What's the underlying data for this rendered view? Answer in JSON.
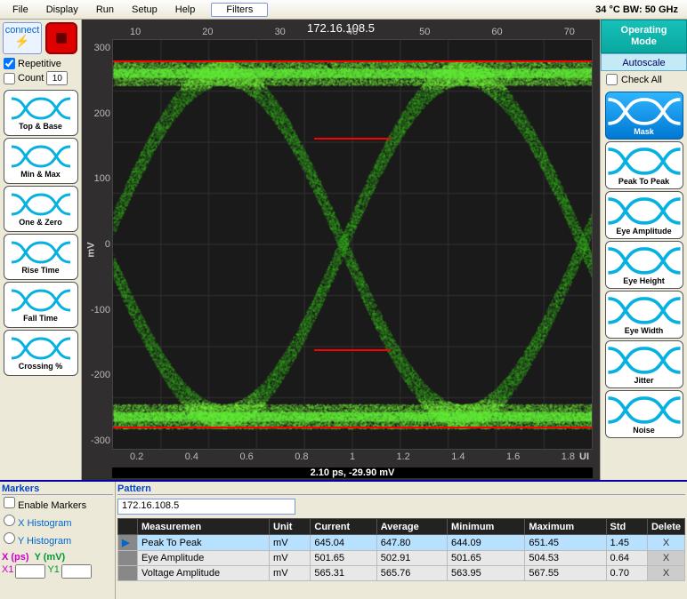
{
  "menu": {
    "items": [
      "File",
      "Display",
      "Run",
      "Setup",
      "Help"
    ],
    "filters": "Filters"
  },
  "status_bar": "34 °C  BW: 50 GHz",
  "controls": {
    "connect": "connect",
    "repetitive_label": "Repetitive",
    "repetitive": true,
    "count_label": "Count",
    "count_checked": false,
    "count_value": "10"
  },
  "left_buttons": [
    {
      "label": "Top & Base"
    },
    {
      "label": "Min & Max"
    },
    {
      "label": "One & Zero"
    },
    {
      "label": "Rise Time"
    },
    {
      "label": "Fall Time"
    },
    {
      "label": "Crossing %"
    }
  ],
  "right_panel": {
    "op_mode_l1": "Operating",
    "op_mode_l2": "Mode",
    "autoscale": "Autoscale",
    "check_all": "Check All",
    "buttons": [
      {
        "label": "Mask",
        "active": true
      },
      {
        "label": "Peak To Peak"
      },
      {
        "label": "Eye Amplitude"
      },
      {
        "label": "Eye Height"
      },
      {
        "label": "Eye Width"
      },
      {
        "label": "Jitter"
      },
      {
        "label": "Noise"
      }
    ]
  },
  "eye": {
    "ip": "172.16.108.5",
    "y_unit": "mV",
    "y_ticks": [
      "300",
      "200",
      "100",
      "0",
      "-100",
      "-200",
      "-300"
    ],
    "x_top": [
      "10",
      "20",
      "30",
      "40",
      "50",
      "60",
      "70"
    ],
    "x_bot": [
      "0.2",
      "0.4",
      "0.6",
      "0.8",
      "1",
      "1.2",
      "1.4",
      "1.6",
      "1.8"
    ],
    "x_unit": "UI",
    "cursor": "2.10 ps, -29.90 mV"
  },
  "markers": {
    "title": "Markers",
    "enable": "Enable Markers",
    "xhist": "X Histogram",
    "yhist": "Y Histogram",
    "xps": "X (ps)",
    "ymv": "Y (mV)",
    "x1": "X1",
    "y1": "Y1"
  },
  "pattern": {
    "title": "Pattern",
    "ip": "172.16.108.5",
    "headers": [
      "",
      "Measuremen",
      "Unit",
      "Current",
      "Average",
      "Minimum",
      "Maximum",
      "Std",
      "Delete"
    ],
    "rows": [
      {
        "sel": true,
        "name": "Peak To Peak",
        "unit": "mV",
        "cur": "645.04",
        "avg": "647.80",
        "min": "644.09",
        "max": "651.45",
        "std": "1.45"
      },
      {
        "sel": false,
        "name": "Eye Amplitude",
        "unit": "mV",
        "cur": "501.65",
        "avg": "502.91",
        "min": "501.65",
        "max": "504.53",
        "std": "0.64"
      },
      {
        "sel": false,
        "name": "Voltage Amplitude",
        "unit": "mV",
        "cur": "565.31",
        "avg": "565.76",
        "min": "563.95",
        "max": "567.55",
        "std": "0.70"
      }
    ],
    "delete_label": "X"
  }
}
